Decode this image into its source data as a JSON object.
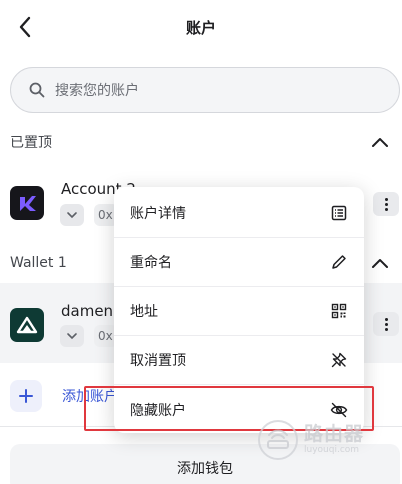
{
  "header": {
    "title": "账户",
    "back_icon": "chevron-left-icon"
  },
  "search": {
    "placeholder": "搜索您的账户",
    "icon": "search-icon"
  },
  "pinned_section": {
    "label": "已置顶"
  },
  "wallet_section": {
    "label": "Wallet 1"
  },
  "accounts": [
    {
      "name": "Account 2",
      "address_prefix": "0x",
      "avatar_color": "#16161b",
      "avatar_accent": "#7b5cff"
    },
    {
      "name": "damen",
      "address_prefix": "0x",
      "avatar_color": "#0e3a34",
      "avatar_accent": "#ffffff"
    }
  ],
  "add_account": {
    "label": "添加账户"
  },
  "add_wallet": {
    "label": "添加钱包"
  },
  "context_menu": {
    "items": [
      {
        "label": "账户详情",
        "icon": "list-icon"
      },
      {
        "label": "重命名",
        "icon": "pencil-icon"
      },
      {
        "label": "地址",
        "icon": "qr-code-icon"
      },
      {
        "label": "取消置顶",
        "icon": "unpin-icon"
      },
      {
        "label": "隐藏账户",
        "icon": "eye-off-icon"
      }
    ]
  },
  "watermark": {
    "title": "路由器",
    "subtitle": "luyouqi.com"
  },
  "colors": {
    "highlight": "#e0383e",
    "link": "#3a57d6"
  }
}
